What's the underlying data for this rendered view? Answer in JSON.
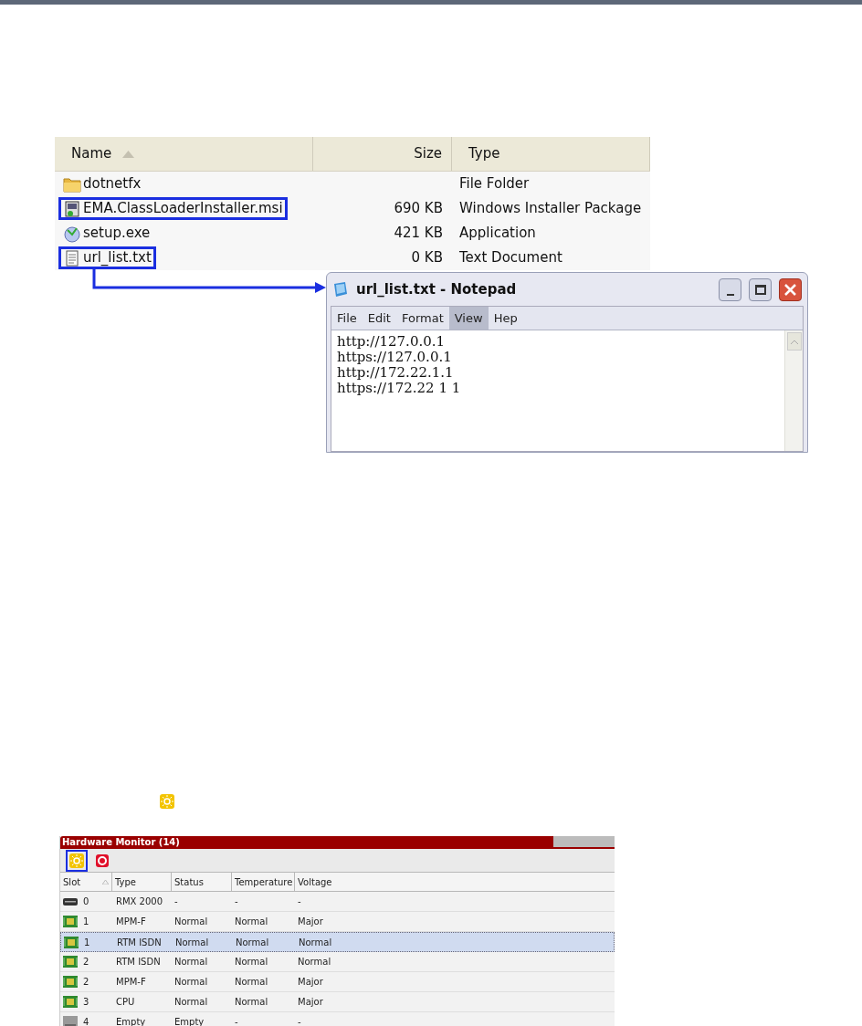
{
  "explorer": {
    "columns": [
      {
        "label": "Name",
        "sorted": true
      },
      {
        "label": "Size",
        "sorted": false
      },
      {
        "label": "Type",
        "sorted": false
      }
    ],
    "rows": [
      {
        "kind": "folder",
        "name": "dotnetfx",
        "type": "File Folder",
        "outlined": false
      },
      {
        "kind": "installer",
        "name": "EMA.ClassLoaderInstaller.msi",
        "size": "690 KB",
        "type": "Windows Installer Package",
        "outlined": true
      },
      {
        "kind": "setup",
        "name": "setup.exe",
        "size": "421 KB",
        "type": "Application",
        "outlined": false
      },
      {
        "kind": "text",
        "name": "url_list.txt",
        "size": "0 KB",
        "type": "Text Document",
        "outlined": true
      }
    ]
  },
  "notepad": {
    "title": "url_list.txt - Notepad",
    "menu": [
      {
        "label": "File",
        "selected": false
      },
      {
        "label": "Edit",
        "selected": false
      },
      {
        "label": "Format",
        "selected": false
      },
      {
        "label": "View",
        "selected": true
      },
      {
        "label": "Hep",
        "selected": false
      }
    ],
    "lines": [
      "http://127.0.0.1",
      "https://127.0.0.1",
      "http://172.22.1.1",
      "https://172.22 1 1"
    ]
  },
  "hardware_monitor": {
    "title": "Hardware Monitor (14)",
    "toolbar": [
      {
        "kind": "sun",
        "outlined": true
      },
      {
        "kind": "stop",
        "outlined": false
      }
    ],
    "columns": [
      "Slot",
      "Type",
      "Status",
      "Temperature",
      "Voltage"
    ],
    "rows": [
      {
        "kind": "chassis",
        "slot": "0",
        "type": "RMX 2000",
        "status": "-",
        "temperature": "-",
        "voltage": "-",
        "selected": false
      },
      {
        "kind": "board",
        "slot": "1",
        "type": "MPM-F",
        "status": "Normal",
        "temperature": "Normal",
        "voltage": "Major",
        "selected": false
      },
      {
        "kind": "board",
        "slot": "1",
        "type": "RTM ISDN",
        "status": "Normal",
        "temperature": "Normal",
        "voltage": "Normal",
        "selected": true
      },
      {
        "kind": "board",
        "slot": "2",
        "type": "RTM ISDN",
        "status": "Normal",
        "temperature": "Normal",
        "voltage": "Normal",
        "selected": false
      },
      {
        "kind": "board",
        "slot": "2",
        "type": "MPM-F",
        "status": "Normal",
        "temperature": "Normal",
        "voltage": "Major",
        "selected": false
      },
      {
        "kind": "board",
        "slot": "3",
        "type": "CPU",
        "status": "Normal",
        "temperature": "Normal",
        "voltage": "Major",
        "selected": false
      },
      {
        "kind": "empty",
        "slot": "4",
        "type": "Empty",
        "status": "Empty",
        "temperature": "-",
        "voltage": "-",
        "selected": false
      }
    ]
  }
}
